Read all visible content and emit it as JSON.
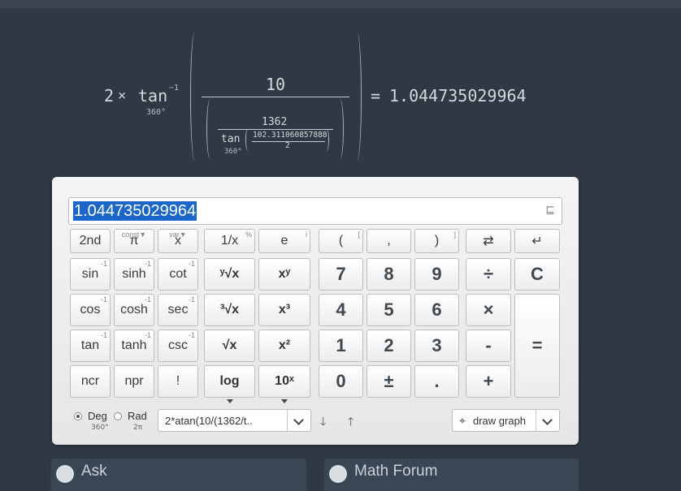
{
  "formula": {
    "coef": "2",
    "times": "×",
    "func": "tan",
    "inv": "−1",
    "unit": "360°",
    "numerator": "10",
    "inner_num": "1362",
    "inner_func": "tan",
    "inner_unit": "360°",
    "inner_arg": "102.311060857888",
    "inner_den": "2",
    "equals": "=",
    "result": "1.044735029964"
  },
  "display": {
    "value": "1.044735029964"
  },
  "keys": {
    "second": "2nd",
    "pi": "π",
    "pi_sup": "const▼",
    "x": "x",
    "x_sup": "var▼",
    "recip": "1/x",
    "recip_sup": "%",
    "e": "e",
    "e_sup": "i",
    "lparen": "(",
    "lparen_sup": "[",
    "comma": ",",
    "rparen": ")",
    "rparen_sup": "]",
    "swap": "⇄",
    "enter": "↵",
    "sin": "sin",
    "sinh": "sinh",
    "cot": "cot",
    "yroot": "ʸ√x",
    "pow": "xʸ",
    "cos": "cos",
    "cosh": "cosh",
    "sec": "sec",
    "cbrt": "³√x",
    "cube": "x³",
    "tan": "tan",
    "tanh": "tanh",
    "csc": "csc",
    "sqrt": "√x",
    "square": "x²",
    "ncr": "ncr",
    "npr": "npr",
    "fact": "!",
    "log": "log",
    "tenpow": "10ˣ",
    "inv_sup": "-1",
    "n7": "7",
    "n8": "8",
    "n9": "9",
    "div": "÷",
    "clear": "C",
    "n4": "4",
    "n5": "5",
    "n6": "6",
    "mul": "×",
    "n1": "1",
    "n2": "2",
    "n3": "3",
    "sub": "-",
    "n0": "0",
    "pm": "±",
    "dot": ".",
    "add": "+",
    "eq": "="
  },
  "mode": {
    "deg": "Deg",
    "deg_sub": "360°",
    "rad": "Rad",
    "rad_sub": "2π",
    "selected": "Deg"
  },
  "history": {
    "value": "2*atan(10/(1362/t.."
  },
  "nav": {
    "down": "🡓",
    "up": "🡑"
  },
  "graph": {
    "label": "draw graph"
  },
  "panels": {
    "ask": "Ask",
    "forum": "Math Forum"
  }
}
